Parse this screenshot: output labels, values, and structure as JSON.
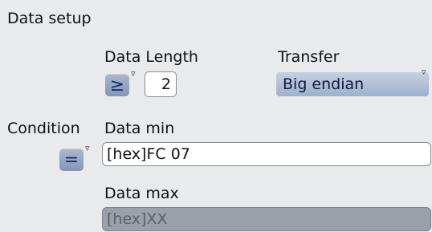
{
  "section": {
    "title": "Data setup"
  },
  "data_length": {
    "label": "Data Length",
    "operator": "≥",
    "value": "2"
  },
  "transfer": {
    "label": "Transfer",
    "selected": "Big endian"
  },
  "condition": {
    "label": "Condition",
    "operator": "="
  },
  "data_min": {
    "label": "Data min",
    "value": "[hex]FC 07"
  },
  "data_max": {
    "label": "Data max",
    "value": "[hex]XX"
  },
  "icons": {
    "dropdown": "▿"
  }
}
